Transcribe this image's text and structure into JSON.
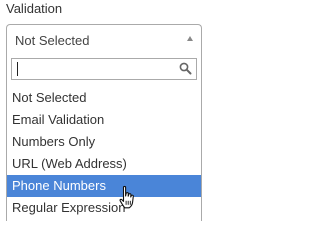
{
  "field": {
    "label": "Validation"
  },
  "select": {
    "selected_value": "Not Selected"
  },
  "search": {
    "value": "",
    "placeholder": ""
  },
  "options": [
    {
      "label": "Not Selected"
    },
    {
      "label": "Email Validation"
    },
    {
      "label": "Numbers Only"
    },
    {
      "label": "URL (Web Address)"
    },
    {
      "label": "Phone Numbers",
      "highlighted": true
    },
    {
      "label": "Regular Expression"
    }
  ],
  "colors": {
    "highlight": "#4a85d8",
    "border": "#aaaaaa",
    "text": "#333333"
  },
  "icons": {
    "search": "magnifier-icon",
    "arrow": "chevron-up-icon",
    "cursor": "hand-pointer-icon"
  }
}
